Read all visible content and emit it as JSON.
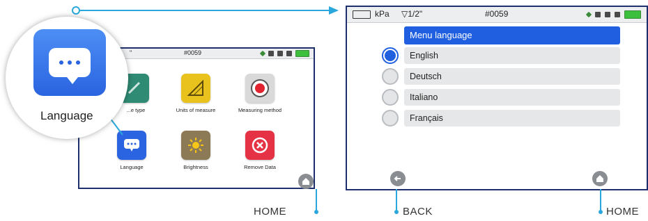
{
  "left_screen": {
    "status": {
      "unit": "\"",
      "id": "#0059"
    },
    "apps": [
      {
        "label": "...e type",
        "icon": "ruler-slant-icon",
        "color": "#2f8b74"
      },
      {
        "label": "Units of measure",
        "icon": "triangle-ruler-icon",
        "color": "#e9c21e"
      },
      {
        "label": "Measuring method",
        "icon": "target-icon",
        "color": "#d9d9d9"
      },
      {
        "label": "Language",
        "icon": "chat-bubble-icon",
        "color": "#2a64e0"
      },
      {
        "label": "Brightness",
        "icon": "sun-icon",
        "color": "#8c7a57"
      },
      {
        "label": "Remove Data",
        "icon": "cross-circle-icon",
        "color": "#e53244"
      }
    ]
  },
  "bubble": {
    "label": "Language"
  },
  "right_screen": {
    "status": {
      "pressure": "kPa",
      "tire": "▽1/2\"",
      "id": "#0059"
    },
    "menu_title": "Menu language",
    "options": [
      {
        "label": "English",
        "selected": true
      },
      {
        "label": "Deutsch",
        "selected": false
      },
      {
        "label": "Italiano",
        "selected": false
      },
      {
        "label": "Français",
        "selected": false
      }
    ]
  },
  "captions": {
    "home_left": "HOME",
    "back": "BACK",
    "home_right": "HOME"
  },
  "colors": {
    "accent": "#2aa7dc",
    "menu_blue": "#1f5fe0",
    "frame": "#1e2f6e"
  }
}
